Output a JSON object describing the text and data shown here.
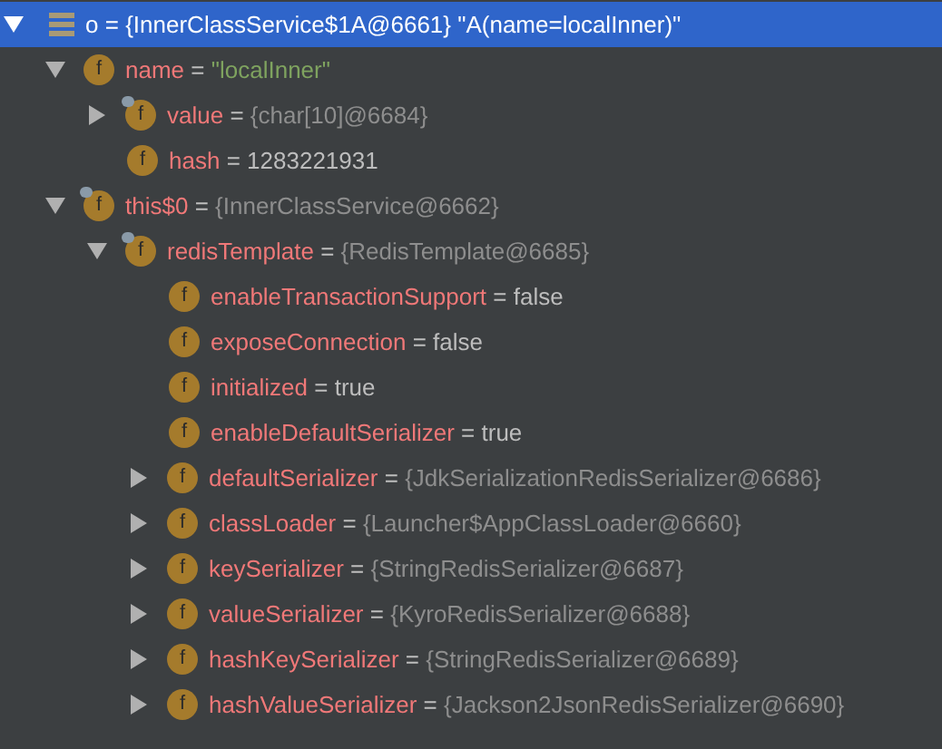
{
  "tree": [
    {
      "kind": "root",
      "selected": true,
      "expanded": true,
      "name": "o",
      "separator": "=",
      "value": {
        "kind": "plain",
        "text": "{InnerClassService$1A@6661} \"A(name=localInner)\""
      },
      "children": [
        {
          "kind": "field",
          "selected": false,
          "icon": "f",
          "marked": false,
          "expanded": true,
          "name": "name",
          "separator": "=",
          "value": {
            "kind": "string",
            "text": "\"localInner\""
          },
          "children": [
            {
              "kind": "field",
              "selected": false,
              "icon": "f",
              "marked": true,
              "expanded": false,
              "name": "value",
              "separator": "=",
              "value": {
                "kind": "ref",
                "text": "{char[10]@6684}"
              }
            },
            {
              "kind": "field",
              "selected": false,
              "icon": "f",
              "marked": false,
              "name": "hash",
              "separator": "=",
              "value": {
                "kind": "literal",
                "text": "1283221931"
              }
            }
          ]
        },
        {
          "kind": "field",
          "selected": false,
          "icon": "f",
          "marked": true,
          "expanded": true,
          "name": "this$0",
          "separator": "=",
          "value": {
            "kind": "ref",
            "text": "{InnerClassService@6662}"
          },
          "children": [
            {
              "kind": "field",
              "selected": false,
              "icon": "f",
              "marked": true,
              "expanded": true,
              "name": "redisTemplate",
              "separator": "=",
              "value": {
                "kind": "ref",
                "text": "{RedisTemplate@6685}"
              },
              "children": [
                {
                  "kind": "field",
                  "selected": false,
                  "icon": "f",
                  "marked": false,
                  "name": "enableTransactionSupport",
                  "separator": "=",
                  "value": {
                    "kind": "literal",
                    "text": "false"
                  }
                },
                {
                  "kind": "field",
                  "selected": false,
                  "icon": "f",
                  "marked": false,
                  "name": "exposeConnection",
                  "separator": "=",
                  "value": {
                    "kind": "literal",
                    "text": "false"
                  }
                },
                {
                  "kind": "field",
                  "selected": false,
                  "icon": "f",
                  "marked": false,
                  "name": "initialized",
                  "separator": "=",
                  "value": {
                    "kind": "literal",
                    "text": "true"
                  }
                },
                {
                  "kind": "field",
                  "selected": false,
                  "icon": "f",
                  "marked": false,
                  "name": "enableDefaultSerializer",
                  "separator": "=",
                  "value": {
                    "kind": "literal",
                    "text": "true"
                  }
                },
                {
                  "kind": "field",
                  "selected": false,
                  "icon": "f",
                  "marked": false,
                  "expanded": false,
                  "name": "defaultSerializer",
                  "separator": "=",
                  "value": {
                    "kind": "ref",
                    "text": "{JdkSerializationRedisSerializer@6686}"
                  }
                },
                {
                  "kind": "field",
                  "selected": false,
                  "icon": "f",
                  "marked": false,
                  "expanded": false,
                  "name": "classLoader",
                  "separator": "=",
                  "value": {
                    "kind": "ref",
                    "text": "{Launcher$AppClassLoader@6660}"
                  }
                },
                {
                  "kind": "field",
                  "selected": false,
                  "icon": "f",
                  "marked": false,
                  "expanded": false,
                  "name": "keySerializer",
                  "separator": "=",
                  "value": {
                    "kind": "ref",
                    "text": "{StringRedisSerializer@6687}"
                  }
                },
                {
                  "kind": "field",
                  "selected": false,
                  "icon": "f",
                  "marked": false,
                  "expanded": false,
                  "name": "valueSerializer",
                  "separator": "=",
                  "value": {
                    "kind": "ref",
                    "text": "{KyroRedisSerializer@6688}"
                  }
                },
                {
                  "kind": "field",
                  "selected": false,
                  "icon": "f",
                  "marked": false,
                  "expanded": false,
                  "name": "hashKeySerializer",
                  "separator": "=",
                  "value": {
                    "kind": "ref",
                    "text": "{StringRedisSerializer@6689}"
                  }
                },
                {
                  "kind": "field",
                  "selected": false,
                  "icon": "f",
                  "marked": false,
                  "expanded": false,
                  "name": "hashValueSerializer",
                  "separator": "=",
                  "value": {
                    "kind": "ref",
                    "text": "{Jackson2JsonRedisSerializer@6690}"
                  }
                }
              ]
            }
          ]
        }
      ]
    }
  ]
}
